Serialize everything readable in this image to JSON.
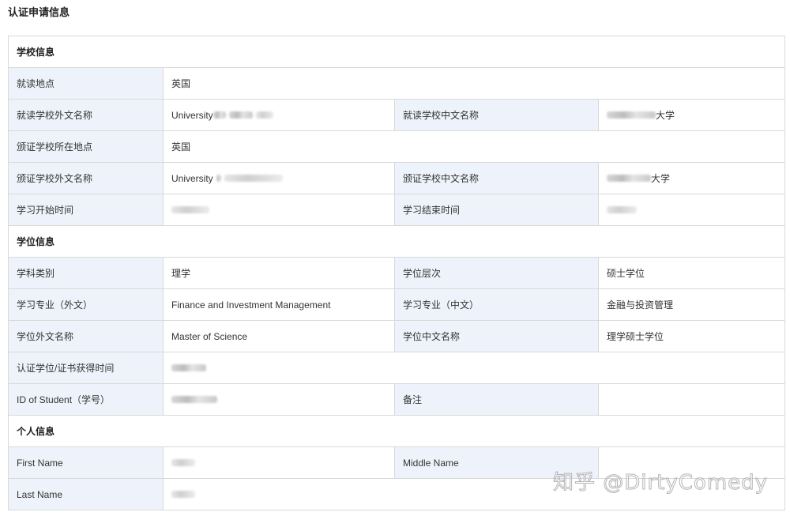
{
  "page": {
    "title": "认证申请信息"
  },
  "school": {
    "section_title": "学校信息",
    "study_location_label": "就读地点",
    "study_location_value": "英国",
    "school_foreign_name_label": "就读学校外文名称",
    "school_foreign_name_prefix": "University",
    "school_chinese_name_label": "就读学校中文名称",
    "school_chinese_name_suffix": "大学",
    "issuing_location_label": "颁证学校所在地点",
    "issuing_location_value": "英国",
    "issuing_foreign_name_label": "颁证学校外文名称",
    "issuing_foreign_name_prefix": "University",
    "issuing_chinese_name_label": "颁证学校中文名称",
    "issuing_chinese_name_suffix": "大学",
    "start_time_label": "学习开始时间",
    "end_time_label": "学习结束时间"
  },
  "degree": {
    "section_title": "学位信息",
    "discipline_label": "学科类别",
    "discipline_value": "理学",
    "level_label": "学位层次",
    "level_value": "硕士学位",
    "major_foreign_label": "学习专业（外文）",
    "major_foreign_value": "Finance and Investment Management",
    "major_chinese_label": "学习专业（中文）",
    "major_chinese_value": "金融与投资管理",
    "degree_foreign_label": "学位外文名称",
    "degree_foreign_value": "Master of Science",
    "degree_chinese_label": "学位中文名称",
    "degree_chinese_value": "理学硕士学位",
    "obtained_time_label": "认证学位/证书获得时间",
    "student_id_label": "ID of Student（学号）",
    "remarks_label": "备注"
  },
  "personal": {
    "section_title": "个人信息",
    "first_name_label": "First Name",
    "middle_name_label": "Middle Name",
    "last_name_label": "Last Name"
  },
  "watermark": {
    "text": "知乎 @DirtyComedy"
  }
}
